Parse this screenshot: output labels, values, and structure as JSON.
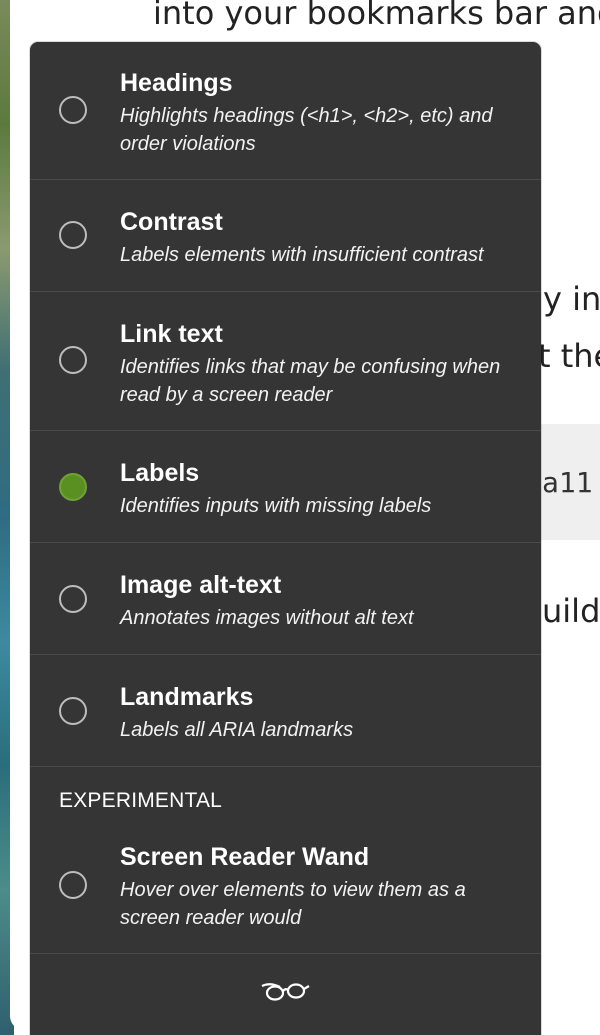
{
  "background_page": {
    "line1": "into your bookmarks bar and",
    "frag1": "y in",
    "frag2": "t the",
    "code_frag": "a11",
    "frag3": "uild t"
  },
  "panel": {
    "items": [
      {
        "title": "Headings",
        "desc": "Highlights headings (<h1>, <h2>, etc) and order violations",
        "checked": false
      },
      {
        "title": "Contrast",
        "desc": "Labels elements with insufficient contrast",
        "checked": false
      },
      {
        "title": "Link text",
        "desc": "Identifies links that may be confusing when read by a screen reader",
        "checked": false
      },
      {
        "title": "Labels",
        "desc": "Identifies inputs with missing labels",
        "checked": true
      },
      {
        "title": "Image alt-text",
        "desc": "Annotates images without alt text",
        "checked": false
      },
      {
        "title": "Landmarks",
        "desc": "Labels all ARIA landmarks",
        "checked": false
      }
    ],
    "section_label": "EXPERIMENTAL",
    "experimental_item": {
      "title": "Screen Reader Wand",
      "desc": "Hover over elements to view them as a screen reader would",
      "checked": false
    },
    "footer_icon": "glasses-icon"
  },
  "colors": {
    "panel_bg": "#353535",
    "divider": "#4b4b4b",
    "checked_radio": "#5a8f22"
  }
}
